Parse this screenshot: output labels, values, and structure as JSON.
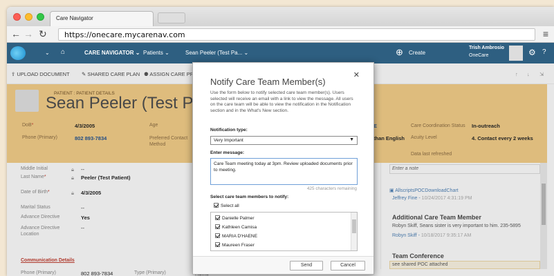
{
  "browser": {
    "tab_title": "Care Navigator",
    "url": "https://onecare.mycarenav.com"
  },
  "header": {
    "app_name": "CARE NAVIGATOR",
    "patients": "Patients",
    "patient_tab": "Sean Peeler (Test Pa...",
    "create": "Create",
    "user_name": "Trish Ambrosio",
    "user_org": "OneCare"
  },
  "toolbar": {
    "upload": "UPLOAD DOCUMENT",
    "shared_plan": "SHARED CARE PLAN",
    "assign": "ASSIGN CARE PR"
  },
  "banner": {
    "crumb": "PATIENT : PATIENT DETAILS",
    "name": "Sean Peeler (Test Patie",
    "dob_label": "DoB",
    "dob": "4/3/2005",
    "age_label": "Age",
    "phone_label": "Phone (Primary)",
    "phone": "802 893-7834",
    "pref_contact_label": "Preferred Contact Method",
    "language": "than English",
    "lang_e": "E",
    "ccs_label": "Care Coordination Status",
    "ccs": "In-outreach",
    "acuity_label": "Acuity Level",
    "acuity": "4. Contact every 2 weeks",
    "refreshed_label": "Data last refreshed"
  },
  "details": {
    "middle_initial_label": "Middle Initial",
    "middle_initial": "--",
    "last_name_label": "Last Name",
    "last_name": "Peeler (Test Patient)",
    "dob_label": "Date of Birth",
    "dob": "4/3/2005",
    "marital_label": "Marital Status",
    "marital": "--",
    "adv_dir_label": "Advance Directive",
    "adv_dir": "Yes",
    "adv_loc_label": "Advance Directive Location",
    "adv_loc": "--",
    "comm_title": "Communication Details",
    "comm_phone_label": "Phone (Primary)",
    "comm_phone": "802 893-7834",
    "comm_type_label": "Type (Primary)",
    "comm_type": "Home"
  },
  "notes": {
    "placeholder": "Enter a note",
    "doc_name": "AllscriptsPOCDownloadChart",
    "doc_author": "Jeffrey Fine -",
    "doc_time": "10/24/2017 4:31:19 PM",
    "note1_title": "Additional Care Team Member",
    "note1_body": "Robyn Skiff, Seans sister is very important to him. 235-5895",
    "note1_author": "Robyn Skiff -",
    "note1_time": "10/18/2017 9:35:17 AM",
    "note2_title": "Team Conference",
    "note2_body": "see shared POC attached"
  },
  "modal": {
    "title": "Notify Care Team Member(s)",
    "description": "Use the form below to notify selected care team member(s). Users selected will receive an email with a link to view the message. All users on the care team will be able to view the notification in the Notification section and in the What's New section.",
    "type_label": "Notification type:",
    "type_value": "Very Important",
    "message_label": "Enter message:",
    "message": "Care Team meeting today at 3pm. Review uploaded documents prior to meeting.",
    "remaining": "425 characters remaining",
    "select_label": "Select care team members to notify:",
    "select_all": "Select all",
    "members": [
      "Danielle Palmer",
      "Kathleen Camisa",
      "MARIA D'HAENE",
      "Maureen Fraser"
    ],
    "send": "Send",
    "cancel": "Cancel"
  },
  "colors": {
    "header": "#2e5f81",
    "banner": "#f5cf87",
    "accent_red": "#c0392b",
    "link_blue": "#4a7fb5"
  }
}
